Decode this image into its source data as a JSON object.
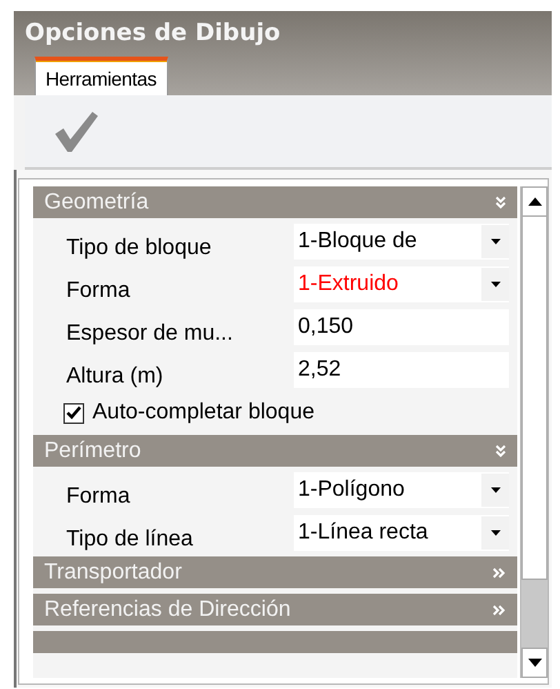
{
  "window": {
    "title": "Opciones de Dibujo"
  },
  "tabs": [
    {
      "label": "Herramientas",
      "selected": true
    }
  ],
  "sections": [
    {
      "title": "Geometría",
      "expanded": true,
      "items": [
        {
          "kind": "dropdown",
          "label": "Tipo de bloque",
          "value": "1-Bloque de"
        },
        {
          "kind": "dropdown",
          "label": "Forma",
          "value": "1-Extruido",
          "color": "#ff0000"
        },
        {
          "kind": "text",
          "label": "Espesor de mu...",
          "value": "0,150"
        },
        {
          "kind": "text",
          "label": "Altura (m)",
          "value": "2,52"
        },
        {
          "kind": "checkbox",
          "label": "Auto-completar bloque",
          "checked": true
        }
      ]
    },
    {
      "title": "Perímetro",
      "expanded": true,
      "items": [
        {
          "kind": "dropdown",
          "label": "Forma",
          "value": "1-Polígono"
        },
        {
          "kind": "dropdown",
          "label": "Tipo de línea",
          "value": "1-Línea recta"
        }
      ]
    },
    {
      "title": "Transportador",
      "expanded": false
    },
    {
      "title": "Referencias de Dirección",
      "expanded": false
    },
    {
      "kind": "stub"
    }
  ]
}
